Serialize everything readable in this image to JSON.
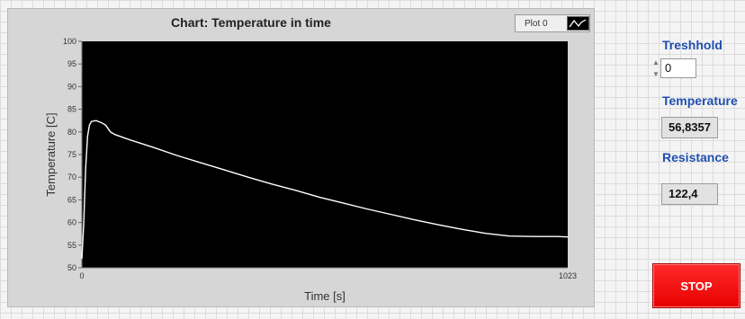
{
  "chart_panel": {
    "title": "Chart: Temperature in time",
    "legend_label": "Plot 0",
    "legend_icon": "line-plot-icon"
  },
  "chart_data": {
    "type": "line",
    "title": "Chart: Temperature in time",
    "xlabel": "Time [s]",
    "ylabel": "Temperature [C]",
    "xlim": [
      0,
      1023
    ],
    "ylim": [
      50,
      100
    ],
    "x_ticks": [
      "0",
      "1023"
    ],
    "y_ticks": [
      "100",
      "95",
      "90",
      "85",
      "80",
      "75",
      "70",
      "65",
      "60",
      "55",
      "50"
    ],
    "grid": false,
    "background": "#000000",
    "line_color": "#ffffff",
    "series": [
      {
        "name": "Plot 0",
        "x": [
          0,
          4,
          8,
          12,
          16,
          20,
          30,
          40,
          50,
          60,
          70,
          100,
          150,
          200,
          250,
          300,
          350,
          400,
          450,
          500,
          550,
          600,
          650,
          700,
          750,
          800,
          850,
          900,
          950,
          1000,
          1023
        ],
        "y": [
          52,
          60,
          72,
          79,
          81.5,
          82.3,
          82.5,
          82.1,
          81.5,
          80,
          79.4,
          78.3,
          76.6,
          74.8,
          73.2,
          71.6,
          70.0,
          68.5,
          67.1,
          65.6,
          64.3,
          63.0,
          61.8,
          60.6,
          59.5,
          58.5,
          57.6,
          57.0,
          56.9,
          56.9,
          56.8
        ]
      }
    ]
  },
  "controls": {
    "threshold_label": "Treshhold",
    "threshold_value": "0",
    "temperature_label": "Temperature",
    "temperature_value": "56,8357",
    "resistance_label": "Resistance",
    "resistance_value": "122,4",
    "stop_label": "STOP"
  },
  "colors": {
    "label_blue": "#1f4fb0",
    "stop_red": "#ff1a1a"
  }
}
